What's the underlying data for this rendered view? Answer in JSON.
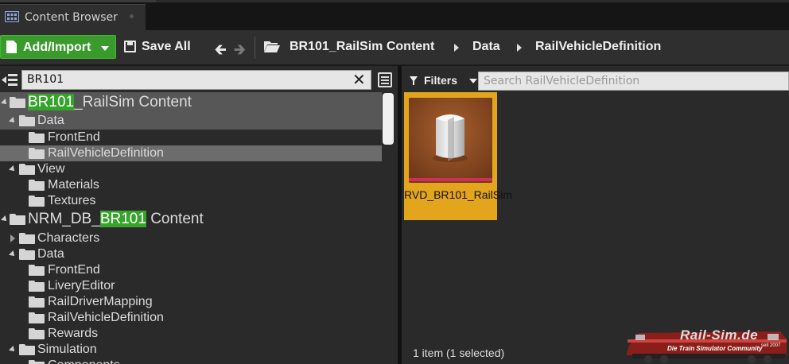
{
  "tab": {
    "title": "Content Browser",
    "icon": "content-browser-icon"
  },
  "toolbar": {
    "add_import_label": "Add/Import",
    "save_all_label": "Save All",
    "breadcrumbs": [
      "BR101_RailSim Content",
      "Data",
      "RailVehicleDefinition"
    ],
    "add_import_color": "#3a9b2d"
  },
  "sources": {
    "search_value": "BR101",
    "tree": [
      {
        "pre": "",
        "hl": "BR101",
        "post": "_RailSim Content"
      },
      {
        "label": "Data"
      },
      {
        "label": "FrontEnd"
      },
      {
        "label": "RailVehicleDefinition"
      },
      {
        "label": "View"
      },
      {
        "label": "Materials"
      },
      {
        "label": "Textures"
      },
      {
        "pre": "NRM_DB_",
        "hl": "BR101",
        "post": " Content"
      },
      {
        "label": "Characters"
      },
      {
        "label": "Data"
      },
      {
        "label": "FrontEnd"
      },
      {
        "label": "LiveryEditor"
      },
      {
        "label": "RailDriverMapping"
      },
      {
        "label": "RailVehicleDefinition"
      },
      {
        "label": "Rewards"
      },
      {
        "label": "Simulation"
      },
      {
        "label": "Components"
      }
    ],
    "highlight_color": "#36a32a"
  },
  "assets": {
    "filters_label": "Filters",
    "search_placeholder": "Search RailVehicleDefinition",
    "items": [
      {
        "name": "RVD_BR101_RailSim",
        "selected": true
      }
    ],
    "status": "1 item (1 selected)",
    "selection_color": "#e3a51b"
  },
  "watermark": {
    "title": "Rail-Sim.de",
    "subtitle": "Die Train Simulator Community",
    "year": "seit 2007"
  }
}
